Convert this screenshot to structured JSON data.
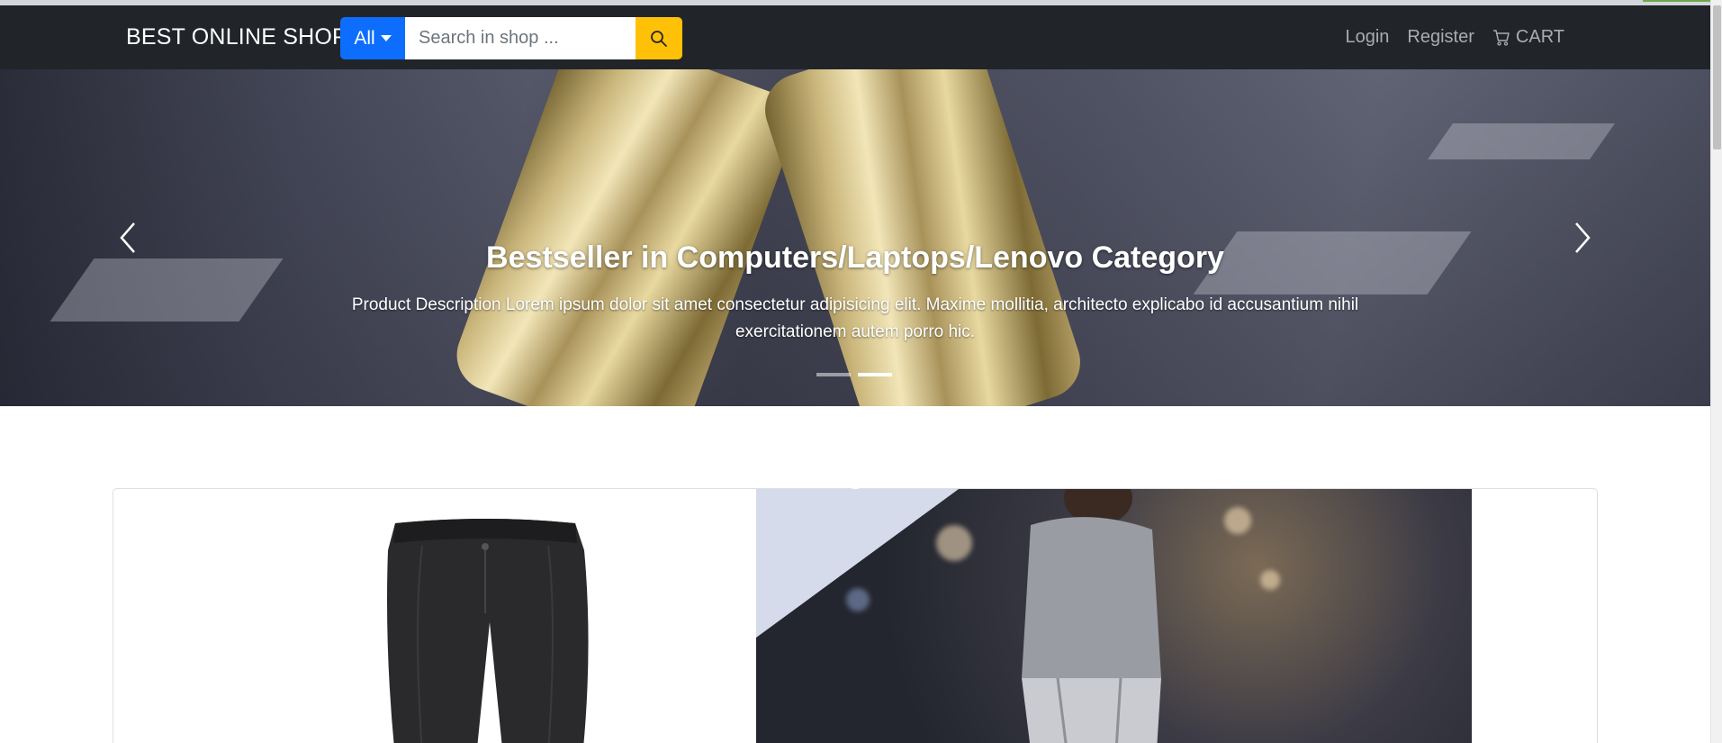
{
  "header": {
    "brand": "BEST ONLINE SHOP",
    "category_dropdown": "All",
    "search": {
      "placeholder": "Search in shop ...",
      "value": ""
    },
    "nav": {
      "login": "Login",
      "register": "Register",
      "cart": "CART"
    }
  },
  "hero": {
    "title": "Bestseller in Computers/Laptops/Lenovo Category",
    "description": "Product Description Lorem ipsum dolor sit amet consectetur adipisicing elit. Maxime mollitia, architecto explicabo id accusantium nihil exercitationem autem porro hic.",
    "slides": 2,
    "active_slide": 2
  },
  "products": [
    {
      "image": "black-trousers"
    },
    {
      "image": "model-grey-sweater-silver-trousers"
    }
  ],
  "colors": {
    "navbar": "#212529",
    "primary": "#0d6efd",
    "warning": "#ffc107",
    "nav_text": "#a9acaf"
  }
}
